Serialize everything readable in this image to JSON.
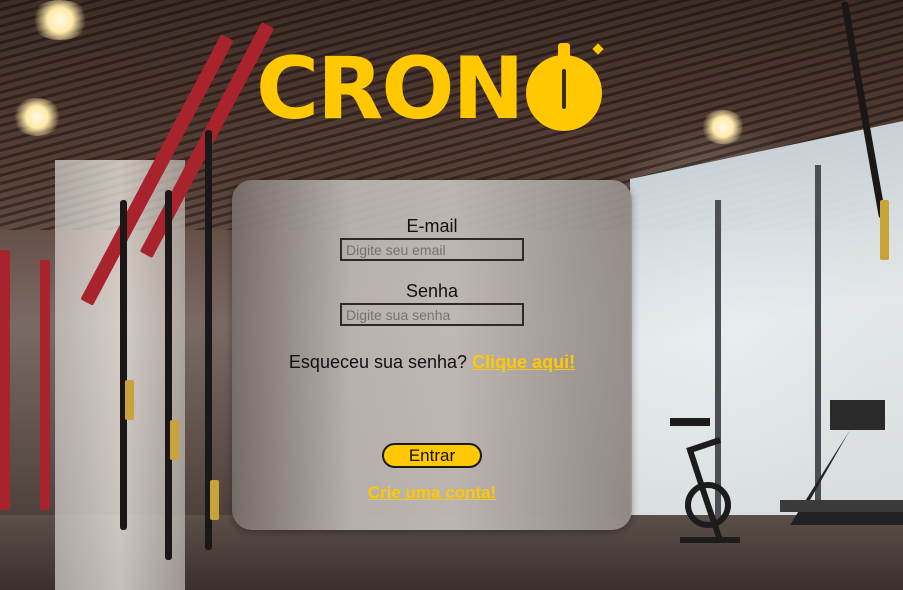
{
  "brand": {
    "logo_text": "CRON",
    "logo_color": "#ffc800"
  },
  "login": {
    "email_label": "E-mail",
    "email_placeholder": "Digite seu email",
    "email_value": "",
    "password_label": "Senha",
    "password_placeholder": "Digite sua senha",
    "password_value": "",
    "forgot_text": "Esqueceu sua senha?",
    "forgot_link": "Clique aqui!",
    "submit_label": "Entrar",
    "signup_link": "Crie uma conta!"
  },
  "background": {
    "scene": "gym-interior"
  }
}
